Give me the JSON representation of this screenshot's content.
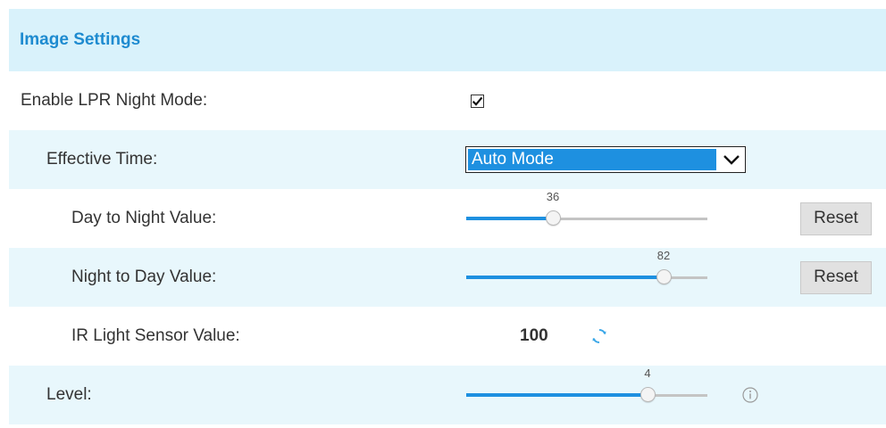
{
  "header": {
    "title": "Image Settings"
  },
  "lpr_night_mode": {
    "label": "Enable LPR Night Mode:",
    "checked": true
  },
  "effective_time": {
    "label": "Effective Time:",
    "selected": "Auto Mode"
  },
  "day_to_night": {
    "label": "Day to Night Value:",
    "value": "36",
    "percent": 36,
    "reset_label": "Reset"
  },
  "night_to_day": {
    "label": "Night to Day Value:",
    "value": "82",
    "percent": 82,
    "reset_label": "Reset"
  },
  "ir_sensor": {
    "label": "IR Light Sensor Value:",
    "value": "100",
    "icon": "refresh-icon"
  },
  "level": {
    "label": "Level:",
    "value": "4",
    "fraction": 0.75,
    "icon": "info-icon"
  },
  "colors": {
    "header_bg": "#d9f2fb",
    "alt_row_bg": "#e8f7fc",
    "accent": "#1e90e0",
    "title": "#1e8bd0"
  }
}
